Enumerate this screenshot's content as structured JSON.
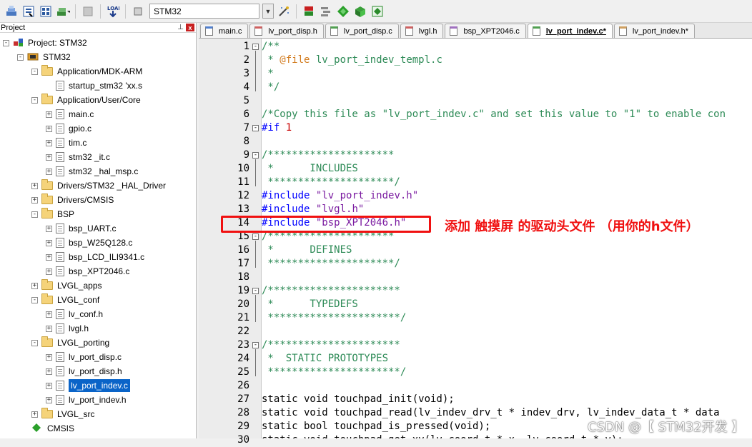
{
  "toolbar": {
    "target": "STM32"
  },
  "project_panel": {
    "title": "Project",
    "pin": "ⱎ",
    "close": "x",
    "root": "Project: STM32",
    "target_node": "STM32",
    "groups": [
      {
        "label": "Application/MDK-ARM",
        "expanded": true,
        "files": [
          "startup_stm32 'xx.s"
        ]
      },
      {
        "label": "Application/User/Core",
        "expanded": true,
        "files": [
          "main.c",
          "gpio.c",
          "tim.c",
          "stm32 _it.c",
          "stm32 _hal_msp.c"
        ]
      },
      {
        "label": "Drivers/STM32 _HAL_Driver",
        "expanded": false,
        "files": []
      },
      {
        "label": "Drivers/CMSIS",
        "expanded": false,
        "files": []
      },
      {
        "label": "BSP",
        "expanded": true,
        "files": [
          "bsp_UART.c",
          "bsp_W25Q128.c",
          "bsp_LCD_ILI9341.c",
          "bsp_XPT2046.c"
        ]
      },
      {
        "label": "LVGL_apps",
        "expanded": false,
        "files": []
      },
      {
        "label": "LVGL_conf",
        "expanded": true,
        "files": [
          "lv_conf.h",
          "lvgl.h"
        ]
      },
      {
        "label": "LVGL_porting",
        "expanded": true,
        "files": [
          "lv_port_disp.c",
          "lv_port_disp.h",
          "lv_port_indev.c",
          "lv_port_indev.h"
        ]
      },
      {
        "label": "LVGL_src",
        "expanded": false,
        "files": []
      },
      {
        "label": "CMSIS",
        "expanded": false,
        "files": []
      }
    ],
    "selected_file": "lv_port_indev.c"
  },
  "tabs": [
    {
      "label": "main.c",
      "active": false
    },
    {
      "label": "lv_port_disp.h",
      "active": false
    },
    {
      "label": "lv_port_disp.c",
      "active": false
    },
    {
      "label": "lvgl.h",
      "active": false
    },
    {
      "label": "bsp_XPT2046.c",
      "active": false
    },
    {
      "label": "lv_port_indev.c*",
      "active": true
    },
    {
      "label": "lv_port_indev.h*",
      "active": false
    }
  ],
  "code_lines": [
    {
      "n": "1",
      "parts": [
        [
          "c",
          "/**"
        ]
      ]
    },
    {
      "n": "2",
      "parts": [
        [
          "c",
          " * "
        ],
        [
          "d",
          "@file"
        ],
        [
          "c",
          " lv_port_indev_templ.c"
        ]
      ]
    },
    {
      "n": "3",
      "parts": [
        [
          "c",
          " *"
        ]
      ]
    },
    {
      "n": "4",
      "parts": [
        [
          "c",
          " */"
        ]
      ]
    },
    {
      "n": "5",
      "parts": []
    },
    {
      "n": "6",
      "parts": [
        [
          "c",
          "/*Copy this file as \"lv_port_indev.c\" and set this value to \"1\" to enable con"
        ]
      ]
    },
    {
      "n": "7",
      "parts": [
        [
          "k",
          "#if"
        ],
        [
          "t",
          " "
        ],
        [
          "num",
          "1"
        ]
      ]
    },
    {
      "n": "8",
      "parts": []
    },
    {
      "n": "9",
      "parts": [
        [
          "c",
          "/*********************"
        ]
      ]
    },
    {
      "n": "10",
      "parts": [
        [
          "c",
          " *      INCLUDES"
        ]
      ]
    },
    {
      "n": "11",
      "parts": [
        [
          "c",
          " *********************/"
        ]
      ]
    },
    {
      "n": "12",
      "parts": [
        [
          "k",
          "#include"
        ],
        [
          "t",
          " "
        ],
        [
          "s",
          "\"lv_port_indev.h\""
        ]
      ]
    },
    {
      "n": "13",
      "parts": [
        [
          "k",
          "#include"
        ],
        [
          "t",
          " "
        ],
        [
          "s",
          "\"lvgl.h\""
        ]
      ]
    },
    {
      "n": "14",
      "parts": [
        [
          "k",
          "#include"
        ],
        [
          "t",
          " "
        ],
        [
          "s",
          "\"bsp_XPT2046.h\""
        ]
      ]
    },
    {
      "n": "15",
      "parts": [
        [
          "c",
          "/*********************"
        ]
      ]
    },
    {
      "n": "16",
      "parts": [
        [
          "c",
          " *      DEFINES"
        ]
      ]
    },
    {
      "n": "17",
      "parts": [
        [
          "c",
          " *********************/"
        ]
      ]
    },
    {
      "n": "18",
      "parts": []
    },
    {
      "n": "19",
      "parts": [
        [
          "c",
          "/**********************"
        ]
      ]
    },
    {
      "n": "20",
      "parts": [
        [
          "c",
          " *      TYPEDEFS"
        ]
      ]
    },
    {
      "n": "21",
      "parts": [
        [
          "c",
          " **********************/"
        ]
      ]
    },
    {
      "n": "22",
      "parts": []
    },
    {
      "n": "23",
      "parts": [
        [
          "c",
          "/**********************"
        ]
      ]
    },
    {
      "n": "24",
      "parts": [
        [
          "c",
          " *  STATIC PROTOTYPES"
        ]
      ]
    },
    {
      "n": "25",
      "parts": [
        [
          "c",
          " **********************/"
        ]
      ]
    },
    {
      "n": "26",
      "parts": []
    },
    {
      "n": "27",
      "parts": [
        [
          "t",
          "static void touchpad_init(void);"
        ]
      ]
    },
    {
      "n": "28",
      "parts": [
        [
          "t",
          "static void touchpad_read(lv_indev_drv_t * indev_drv, lv_indev_data_t * data"
        ]
      ]
    },
    {
      "n": "29",
      "parts": [
        [
          "t",
          "static bool touchpad_is_pressed(void);"
        ]
      ]
    },
    {
      "n": "30",
      "parts": [
        [
          "t",
          "static void touchpad_get_xy(lv_coord_t * x, lv_coord_t * y);"
        ]
      ]
    }
  ],
  "annotation": "添加 触摸屏 的驱动头文件  （用你的h文件）",
  "watermark": "CSDN @【 STM32开发 】",
  "colors": {
    "comment": "#2e8b57",
    "keyword": "#0000ff",
    "string": "#7a1aa0",
    "highlight": "#f01010",
    "selection": "#0a64c8"
  }
}
